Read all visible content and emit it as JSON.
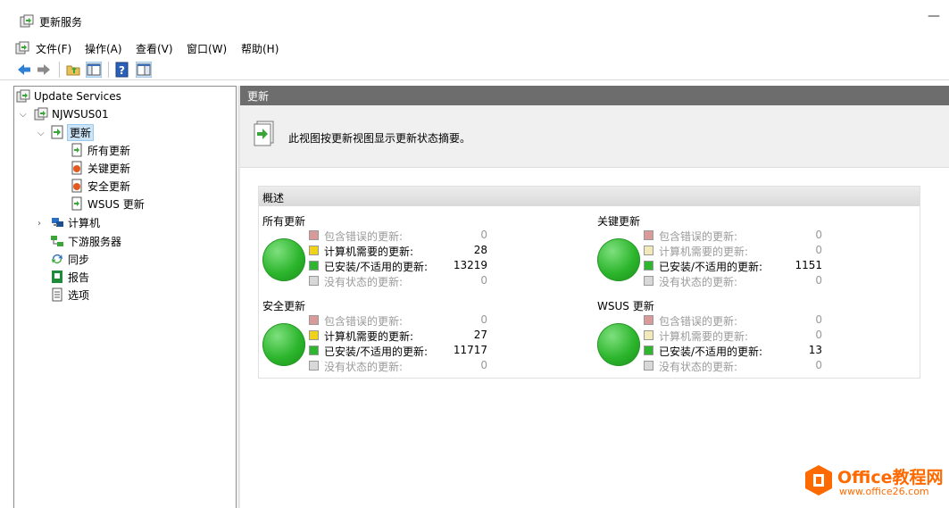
{
  "window": {
    "title": "更新服务"
  },
  "menu": [
    "文件(F)",
    "操作(A)",
    "查看(V)",
    "窗口(W)",
    "帮助(H)"
  ],
  "tree": {
    "root": "Update Services",
    "server": "NJWSUS01",
    "updates": "更新",
    "children": [
      "所有更新",
      "关键更新",
      "安全更新",
      "WSUS 更新"
    ],
    "others": [
      "计算机",
      "下游服务器",
      "同步",
      "报告",
      "选项"
    ]
  },
  "content": {
    "header": "更新",
    "description": "此视图按更新视图显示更新状态摘要。",
    "overview_title": "概述",
    "groups": [
      {
        "title": "所有更新",
        "rows": [
          {
            "label": "包含错误的更新:",
            "value": "0",
            "color": "#d99a9a",
            "dim": true
          },
          {
            "label": "计算机需要的更新:",
            "value": "28",
            "color": "#f1d21a",
            "dim": false
          },
          {
            "label": "已安装/不适用的更新:",
            "value": "13219",
            "color": "#2fb52f",
            "dim": false
          },
          {
            "label": "没有状态的更新:",
            "value": "0",
            "color": "#d8d8d8",
            "dim": true
          }
        ]
      },
      {
        "title": "关键更新",
        "rows": [
          {
            "label": "包含错误的更新:",
            "value": "0",
            "color": "#d99a9a",
            "dim": true
          },
          {
            "label": "计算机需要的更新:",
            "value": "0",
            "color": "#f3e9b8",
            "dim": true
          },
          {
            "label": "已安装/不适用的更新:",
            "value": "1151",
            "color": "#2fb52f",
            "dim": false
          },
          {
            "label": "没有状态的更新:",
            "value": "0",
            "color": "#d8d8d8",
            "dim": true
          }
        ]
      },
      {
        "title": "安全更新",
        "rows": [
          {
            "label": "包含错误的更新:",
            "value": "0",
            "color": "#d99a9a",
            "dim": true
          },
          {
            "label": "计算机需要的更新:",
            "value": "27",
            "color": "#f1d21a",
            "dim": false
          },
          {
            "label": "已安装/不适用的更新:",
            "value": "11717",
            "color": "#2fb52f",
            "dim": false
          },
          {
            "label": "没有状态的更新:",
            "value": "0",
            "color": "#d8d8d8",
            "dim": true
          }
        ]
      },
      {
        "title": "WSUS 更新",
        "rows": [
          {
            "label": "包含错误的更新:",
            "value": "0",
            "color": "#d99a9a",
            "dim": true
          },
          {
            "label": "计算机需要的更新:",
            "value": "0",
            "color": "#f3e9b8",
            "dim": true
          },
          {
            "label": "已安装/不适用的更新:",
            "value": "13",
            "color": "#2fb52f",
            "dim": false
          },
          {
            "label": "没有状态的更新:",
            "value": "0",
            "color": "#d8d8d8",
            "dim": true
          }
        ]
      }
    ]
  },
  "watermark": {
    "line1": "Office教程网",
    "line2": "www.office26.com"
  }
}
